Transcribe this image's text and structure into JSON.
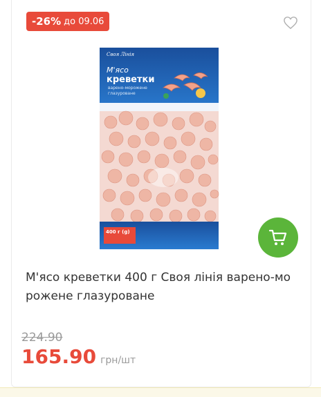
{
  "badge": {
    "discount": "-26%",
    "until": "до 09.06"
  },
  "product": {
    "name": "М'ясо креветки 400 г Своя лінія варено-мо рожене глазуроване",
    "old_price": "224.90",
    "price": "165.90",
    "unit": "грн/шт",
    "package": {
      "brand": "Своя Лінія",
      "title_line1": "М'ясо",
      "title_line2": "креветки",
      "subtitle_line1": "варено-морожене",
      "subtitle_line2": "глазуроване",
      "weight": "400 г (g)"
    }
  },
  "icons": {
    "favorite": "heart-outline-icon",
    "cart": "cart-icon"
  },
  "colors": {
    "accent_red": "#e84a3a",
    "cart_green": "#5bb53a",
    "pack_blue": "#1f63b5"
  }
}
